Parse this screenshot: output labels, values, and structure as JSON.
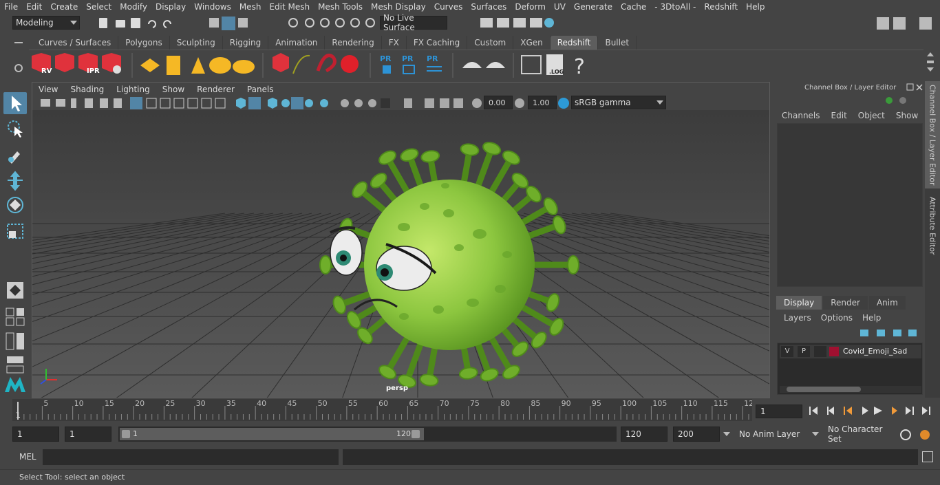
{
  "menubar": {
    "items": [
      "File",
      "Edit",
      "Create",
      "Select",
      "Modify",
      "Display",
      "Windows",
      "Mesh",
      "Edit Mesh",
      "Mesh Tools",
      "Mesh Display",
      "Curves",
      "Surfaces",
      "Deform",
      "UV",
      "Generate",
      "Cache",
      "- 3DtoAll -",
      "Redshift",
      "Help"
    ]
  },
  "status_line": {
    "workspace": "Modeling",
    "live_surface": "No Live Surface"
  },
  "shelf": {
    "tabs": [
      "Curves / Surfaces",
      "Polygons",
      "Sculpting",
      "Rigging",
      "Animation",
      "Rendering",
      "FX",
      "FX Caching",
      "Custom",
      "XGen",
      "Redshift",
      "Bullet"
    ],
    "active_tab": "Redshift",
    "icon_labels": [
      "RV",
      "IPR",
      "PR",
      "PR",
      "PR",
      ".LOG",
      "?"
    ]
  },
  "viewport": {
    "menu": [
      "View",
      "Shading",
      "Lighting",
      "Show",
      "Renderer",
      "Panels"
    ],
    "exposure": "0.00",
    "gamma": "1.00",
    "color_space": "sRGB gamma",
    "camera_label": "persp"
  },
  "channel_box": {
    "title": "Channel Box / Layer Editor",
    "menu": [
      "Channels",
      "Edit",
      "Object",
      "Show"
    ],
    "layer_tabs": [
      "Display",
      "Render",
      "Anim"
    ],
    "active_layer_tab": "Display",
    "layer_menu": [
      "Layers",
      "Options",
      "Help"
    ],
    "layer": {
      "visible": "V",
      "playback": "P",
      "name": "Covid_Emoji_Sad",
      "color": "#a01030"
    }
  },
  "side_tabs": [
    "Channel Box / Layer Editor",
    "Attribute Editor"
  ],
  "timeline": {
    "ticks": [
      "1",
      "5",
      "10",
      "15",
      "20",
      "25",
      "30",
      "35",
      "40",
      "45",
      "50",
      "55",
      "60",
      "65",
      "70",
      "75",
      "80",
      "85",
      "90",
      "95",
      "100",
      "105",
      "110",
      "115",
      "12"
    ],
    "current_frame": "1"
  },
  "range": {
    "start": "1",
    "playback_start": "1",
    "slider_start": "1",
    "slider_end": "120",
    "playback_end": "120",
    "end": "200",
    "anim_layer": "No Anim Layer",
    "character_set": "No Character Set"
  },
  "command_line": {
    "label": "MEL"
  },
  "help_line": {
    "text": "Select Tool: select an object"
  },
  "colors": {
    "accent": "#5285a6",
    "virus_green": "#8cc63f",
    "redshift_red": "#e0323c"
  }
}
